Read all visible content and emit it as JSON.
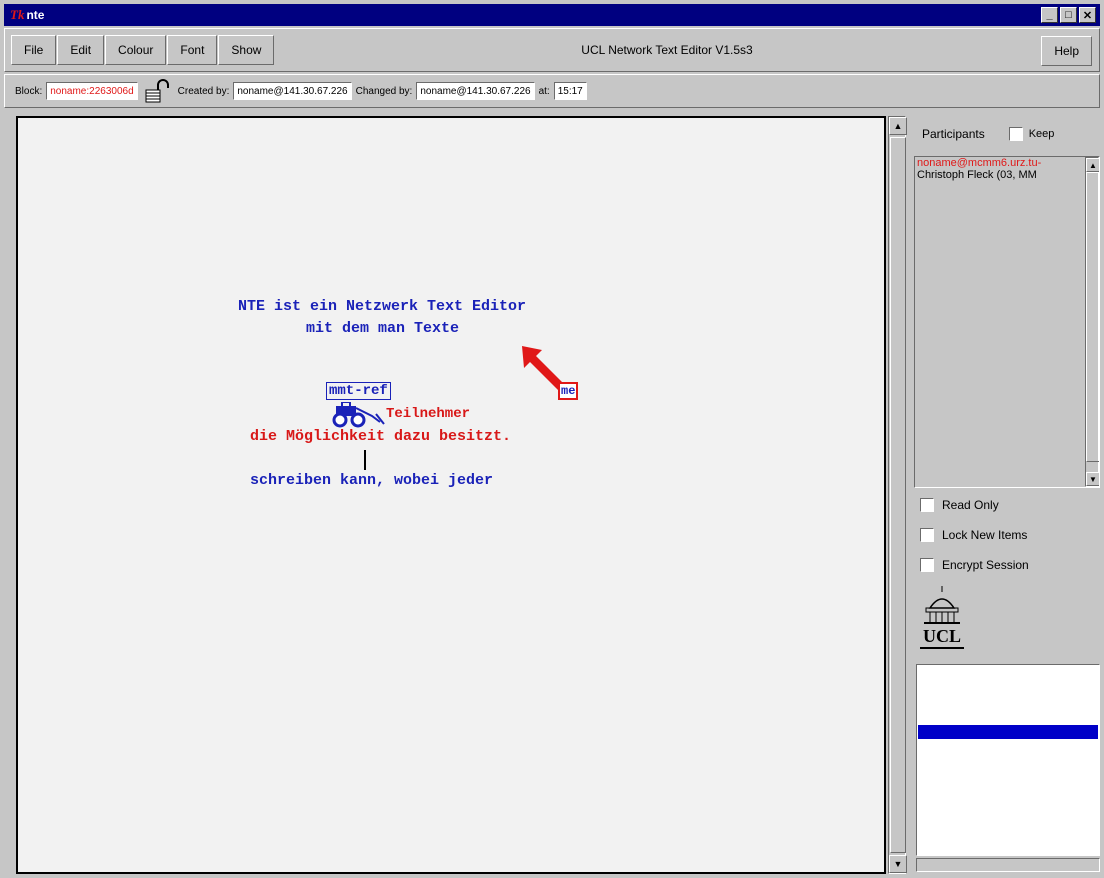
{
  "window": {
    "title": "nte"
  },
  "menu": {
    "items": [
      "File",
      "Edit",
      "Colour",
      "Font",
      "Show"
    ],
    "app_title": "UCL Network Text Editor V1.5s3",
    "help": "Help"
  },
  "info": {
    "block_label": "Block:",
    "block_value": "noname:2263006d",
    "created_label": "Created by:",
    "created_value": "noname@141.30.67.226",
    "changed_label": "Changed by:",
    "changed_value": "noname@141.30.67.226",
    "at_label": "at:",
    "at_value": "15:17"
  },
  "canvas": {
    "line1": "NTE ist ein Netzwerk Text Editor",
    "line2": "mit dem man Texte",
    "ref_box": "mmt-ref",
    "teilnehmer": "Teilnehmer",
    "line_red": "die Möglichkeit dazu besitzt.",
    "line_blue": "schreiben kann, wobei jeder",
    "pointer_label": "me"
  },
  "participants": {
    "header": "Participants",
    "keep": "Keep",
    "list": [
      {
        "name": "noname@mcmm6.urz.tu-",
        "self": true
      },
      {
        "name": "Christoph Fleck (03, MM",
        "self": false
      }
    ]
  },
  "options": {
    "read_only": "Read Only",
    "lock_new": "Lock New Items",
    "encrypt": "Encrypt Session"
  },
  "logo_text": "UCL",
  "colors": {
    "titlebar": "#000080",
    "text_blue": "#1a22b8",
    "text_red": "#d81818"
  }
}
